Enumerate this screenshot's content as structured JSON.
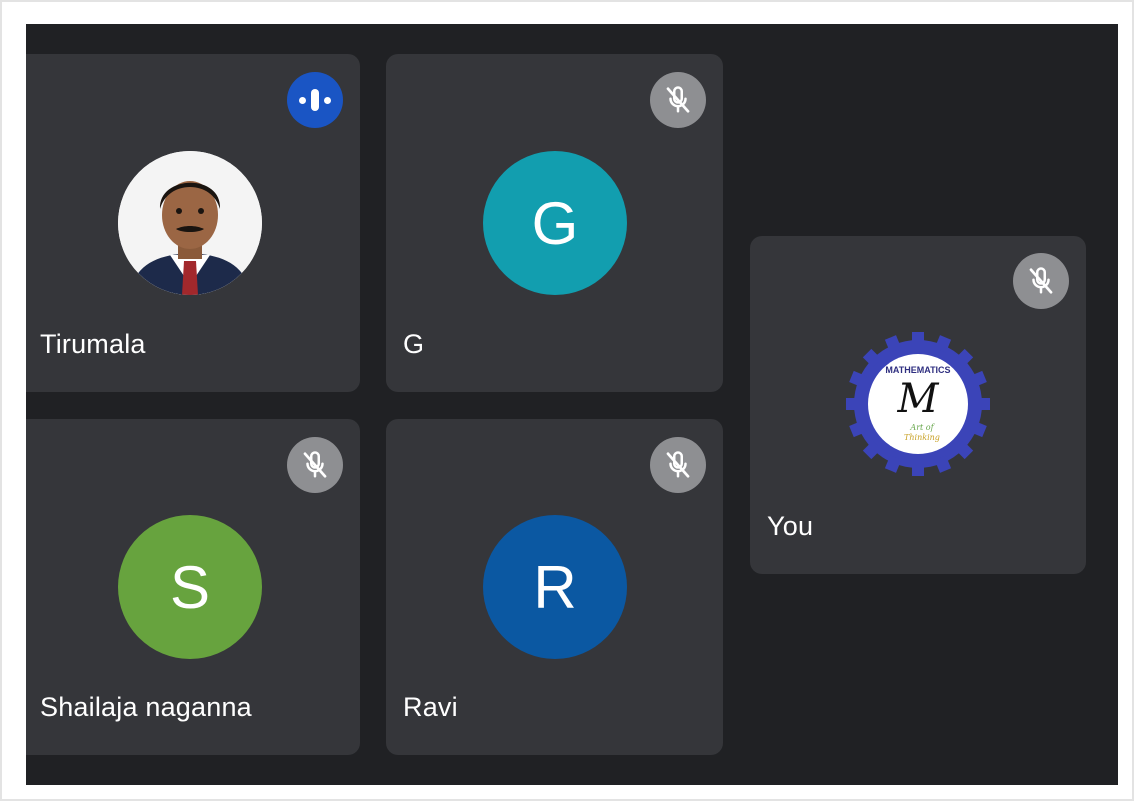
{
  "participants": [
    {
      "name": "Tirumala",
      "status": "speaking",
      "avatar": "photo"
    },
    {
      "name": "G",
      "initial": "G",
      "status": "muted",
      "avatar_color": "#129eaf"
    },
    {
      "name": "You",
      "status": "muted",
      "avatar": "logo",
      "logo_text": {
        "top": "MATHEMATICS",
        "letter": "M",
        "bottom_line1": "Art of",
        "bottom_line2": "Thinking"
      }
    },
    {
      "name": "Shailaja naganna",
      "initial": "S",
      "status": "muted",
      "avatar_color": "#67a33e"
    },
    {
      "name": "Ravi",
      "initial": "R",
      "status": "muted",
      "avatar_color": "#0b58a2"
    }
  ],
  "icons": {
    "muted": "mic-off-icon",
    "speaking": "audio-level-icon"
  },
  "colors": {
    "stage_background": "#202124",
    "tile_background": "#35363a",
    "muted_badge": "#8e8f92",
    "speaking_badge": "#1a55c4"
  }
}
